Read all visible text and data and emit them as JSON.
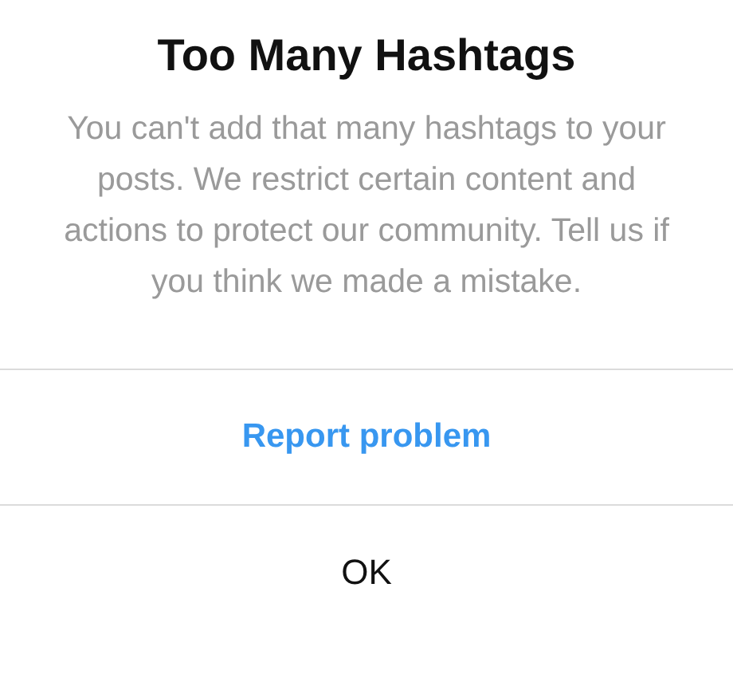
{
  "dialog": {
    "title": "Too Many Hashtags",
    "message": "You can't add that many hashtags to your posts. We restrict certain content and actions to protect our community. Tell us if you think we made a mistake.",
    "buttons": [
      {
        "label": "Report problem",
        "kind": "primary"
      },
      {
        "label": "OK",
        "kind": "plain"
      }
    ]
  }
}
